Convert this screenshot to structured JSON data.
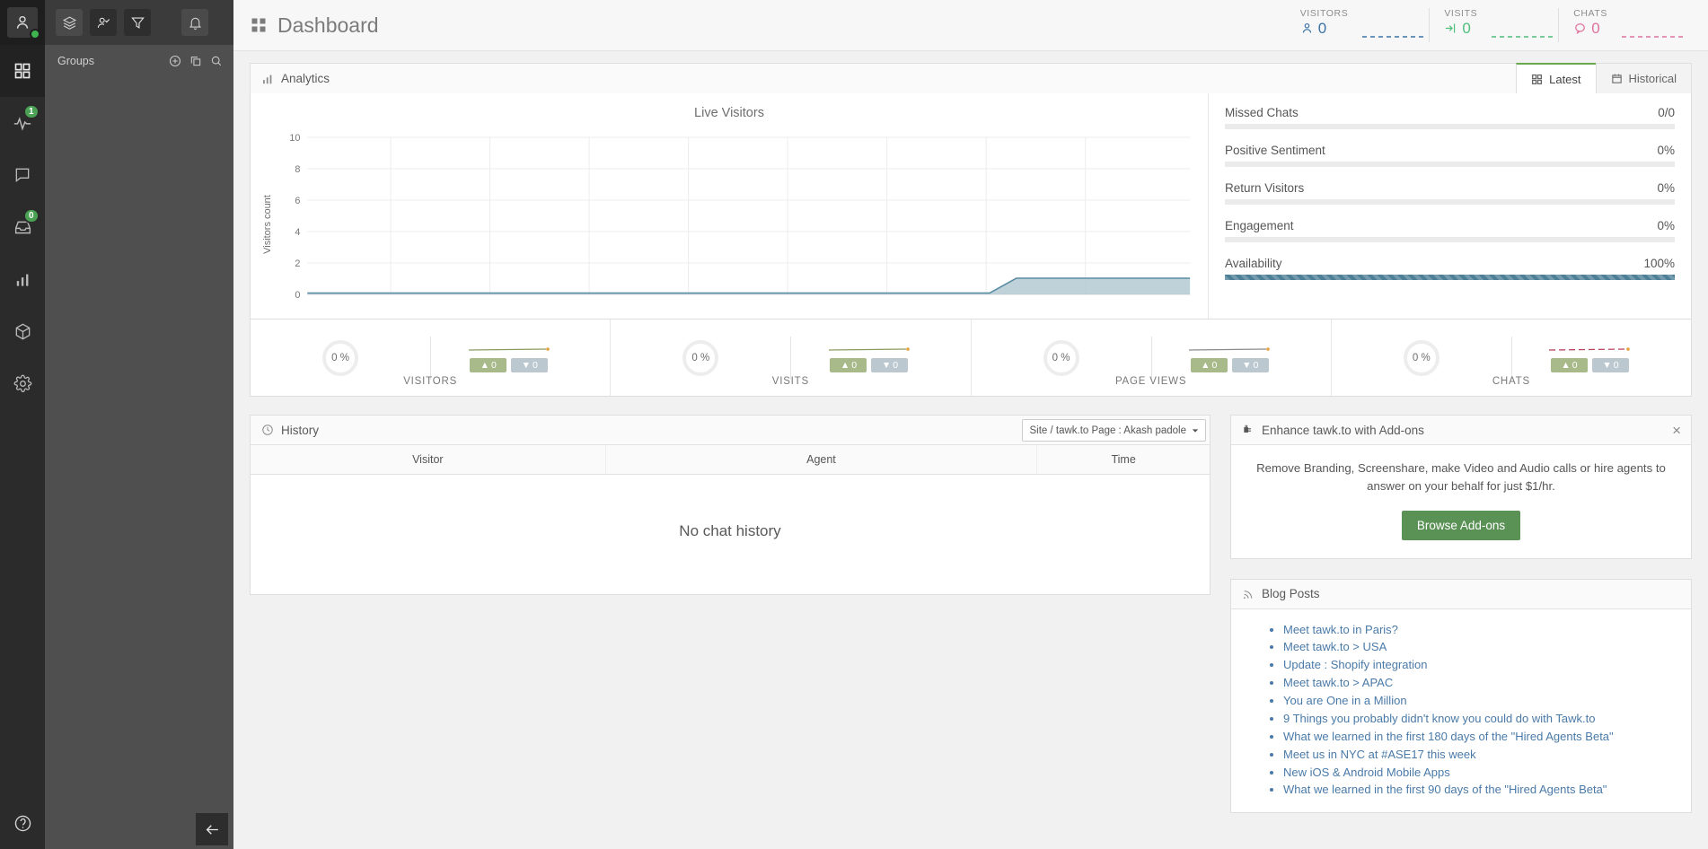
{
  "rail": {
    "avatar": {
      "icon": "user-avatar-icon",
      "status": "online"
    },
    "items": [
      {
        "name": "dashboard",
        "icon": "grid-icon",
        "badge": null,
        "active": true
      },
      {
        "name": "monitoring",
        "icon": "pulse-icon",
        "badge": "1",
        "active": false
      },
      {
        "name": "chats",
        "icon": "chat-bubble-icon",
        "badge": null,
        "active": false
      },
      {
        "name": "inbox",
        "icon": "inbox-icon",
        "badge": "0",
        "active": false
      },
      {
        "name": "reporting",
        "icon": "bar-chart-icon",
        "badge": null,
        "active": false
      },
      {
        "name": "addons",
        "icon": "box-icon",
        "badge": null,
        "active": false
      },
      {
        "name": "settings",
        "icon": "gear-icon",
        "badge": null,
        "active": false
      }
    ],
    "help": {
      "icon": "help-circle-icon"
    }
  },
  "groups": {
    "toolbar": [
      {
        "name": "layers",
        "icon": "layers-icon"
      },
      {
        "name": "agents",
        "icon": "user-check-icon"
      },
      {
        "name": "filter",
        "icon": "filter-icon"
      },
      {
        "name": "notifications",
        "icon": "bell-icon"
      }
    ],
    "title": "Groups",
    "actions": [
      {
        "name": "add-group",
        "icon": "plus-circle-icon"
      },
      {
        "name": "copy",
        "icon": "copy-icon"
      },
      {
        "name": "search",
        "icon": "search-icon"
      }
    ],
    "collapse": {
      "icon": "arrow-left-icon"
    }
  },
  "header": {
    "icon": "grid-icon",
    "title": "Dashboard",
    "stats": [
      {
        "label": "VISITORS",
        "value": "0",
        "icon": "person-icon",
        "color": "#3a73a8"
      },
      {
        "label": "VISITS",
        "value": "0",
        "icon": "login-arrow-icon",
        "color": "#4dbf7a"
      },
      {
        "label": "CHATS",
        "value": "0",
        "icon": "chat-icon",
        "color": "#e0719d"
      }
    ]
  },
  "analytics": {
    "icon": "bar-chart-icon",
    "title": "Analytics",
    "tabs": [
      {
        "label": "Latest",
        "icon": "grid-icon",
        "active": true
      },
      {
        "label": "Historical",
        "icon": "calendar-icon",
        "active": false
      }
    ],
    "metrics": [
      {
        "name": "Missed Chats",
        "value": "0/0",
        "fill_pct": 0
      },
      {
        "name": "Positive Sentiment",
        "value": "0%",
        "fill_pct": 0
      },
      {
        "name": "Return Visitors",
        "value": "0%",
        "fill_pct": 0
      },
      {
        "name": "Engagement",
        "value": "0%",
        "fill_pct": 0
      },
      {
        "name": "Availability",
        "value": "100%",
        "fill_pct": 100
      }
    ],
    "fill_color": "#4d7f96"
  },
  "chart_data": {
    "type": "area",
    "title": "Live Visitors",
    "xlabel": "",
    "ylabel": "Visitors count",
    "ylim": [
      0,
      10
    ],
    "yticks": [
      0,
      2,
      4,
      6,
      8,
      10
    ],
    "grid": true,
    "legend": "none",
    "series": [
      {
        "name": "Live Visitors",
        "line_color": "#5a8ca3",
        "fill_color": "#b4cad3",
        "x": [
          0,
          10,
          20,
          30,
          40,
          50,
          60,
          70,
          78,
          80,
          86,
          100
        ],
        "values": [
          0,
          0,
          0,
          0,
          0,
          0,
          0,
          0,
          0,
          1,
          1,
          1
        ]
      }
    ]
  },
  "cards": [
    {
      "label": "VISITORS",
      "percent": "0 %",
      "up": "0",
      "down": "0",
      "spark_color": "#8a9b5e",
      "spark_dot": "#e2a33c"
    },
    {
      "label": "VISITS",
      "percent": "0 %",
      "up": "0",
      "down": "0",
      "spark_color": "#8a9b5e",
      "spark_dot": "#e2a33c"
    },
    {
      "label": "PAGE VIEWS",
      "percent": "0 %",
      "up": "0",
      "down": "0",
      "spark_color": "#8a8a8a",
      "spark_dot": "#e2a33c"
    },
    {
      "label": "CHATS",
      "percent": "0 %",
      "up": "0",
      "down": "0",
      "spark_color": "#b9435c",
      "spark_dot": "#e2a33c"
    }
  ],
  "history": {
    "icon": "clock-icon",
    "title": "History",
    "selector": "Site / tawk.to Page : Akash padole",
    "columns": [
      "Visitor",
      "Agent",
      "Time"
    ],
    "empty_text": "No chat history"
  },
  "addons": {
    "icon": "plug-icon",
    "title": "Enhance tawk.to with Add-ons",
    "close_icon": "close-icon",
    "body": "Remove Branding, Screenshare, make Video and Audio calls or hire agents to answer on your behalf for just $1/hr.",
    "button": "Browse Add-ons",
    "button_color": "#5a9155"
  },
  "blog": {
    "icon": "rss-icon",
    "title": "Blog Posts",
    "posts": [
      "Meet tawk.to in Paris?",
      "Meet tawk.to > USA",
      "Update : Shopify integration",
      "Meet tawk.to > APAC",
      "You are One in a Million",
      "9 Things you probably didn't know you could do with Tawk.to",
      "What we learned in the first 180 days of the \"Hired Agents Beta\"",
      "Meet us in NYC at #ASE17 this week",
      "New iOS & Android Mobile Apps",
      "What we learned in the first 90 days of the \"Hired Agents Beta\""
    ],
    "link_color": "#4a7aa8"
  }
}
